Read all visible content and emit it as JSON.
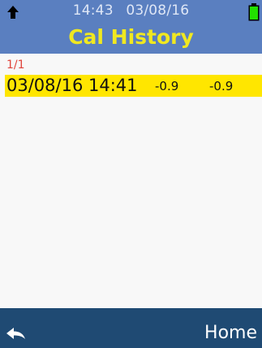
{
  "status": {
    "time": "14:43",
    "date": "03/08/16",
    "up_icon": "up-arrow-icon",
    "battery_icon": "battery-icon"
  },
  "screen": {
    "title": "Cal History"
  },
  "list": {
    "page_indicator": "1/1",
    "rows": [
      {
        "datetime": "03/08/16 14:41",
        "value_1": "-0.9",
        "value_2": "-0.9"
      }
    ]
  },
  "footer": {
    "back_icon": "back-arrow-icon",
    "home_label": "Home"
  },
  "colors": {
    "header_bg": "#5a7fc0",
    "title": "#f0e820",
    "highlight_row": "#ffe600",
    "page_indicator": "#e0443c",
    "footer_bg": "#1f4a73",
    "battery": "#22e000"
  }
}
